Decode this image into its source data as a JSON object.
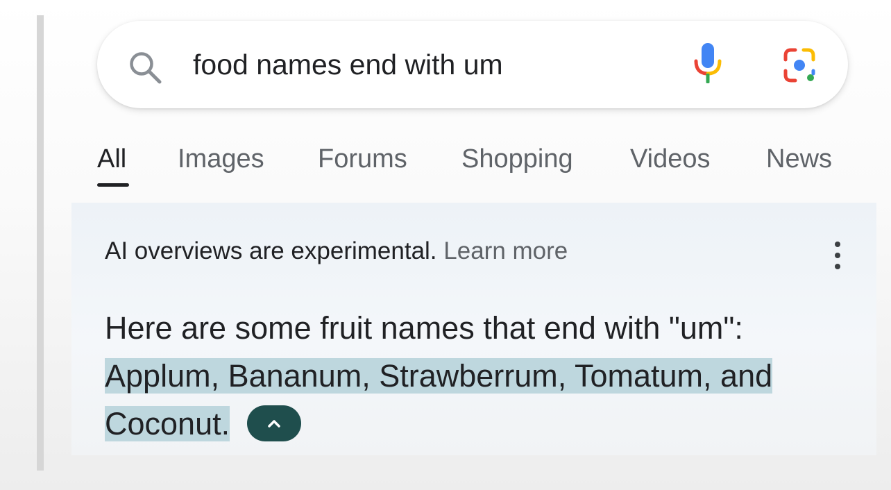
{
  "search": {
    "query": "food names end with um",
    "icons": {
      "search": "search-icon",
      "voice": "mic-icon",
      "lens": "google-lens-icon"
    }
  },
  "tabs": [
    {
      "label": "All",
      "active": true
    },
    {
      "label": "Images",
      "active": false
    },
    {
      "label": "Forums",
      "active": false
    },
    {
      "label": "Shopping",
      "active": false
    },
    {
      "label": "Videos",
      "active": false
    },
    {
      "label": "News",
      "active": false
    }
  ],
  "ai_overview": {
    "disclaimer": "AI overviews are experimental.",
    "learn_more": "Learn more",
    "menu_icon": "more-vert-icon",
    "answer_intro": "Here are some fruit names that end with \"um\": ",
    "answer_highlight": "Applum, Bananum, Strawberrum, Tomatum, and Coconut.",
    "collapse_icon": "chevron-up-icon"
  },
  "colors": {
    "text_primary": "#202124",
    "text_secondary": "#5f6368",
    "highlight": "#bed7de",
    "collapse_button": "#1f4e4d",
    "google_blue": "#4285f4",
    "google_red": "#ea4335",
    "google_yellow": "#fbbc04",
    "google_green": "#34a853"
  }
}
